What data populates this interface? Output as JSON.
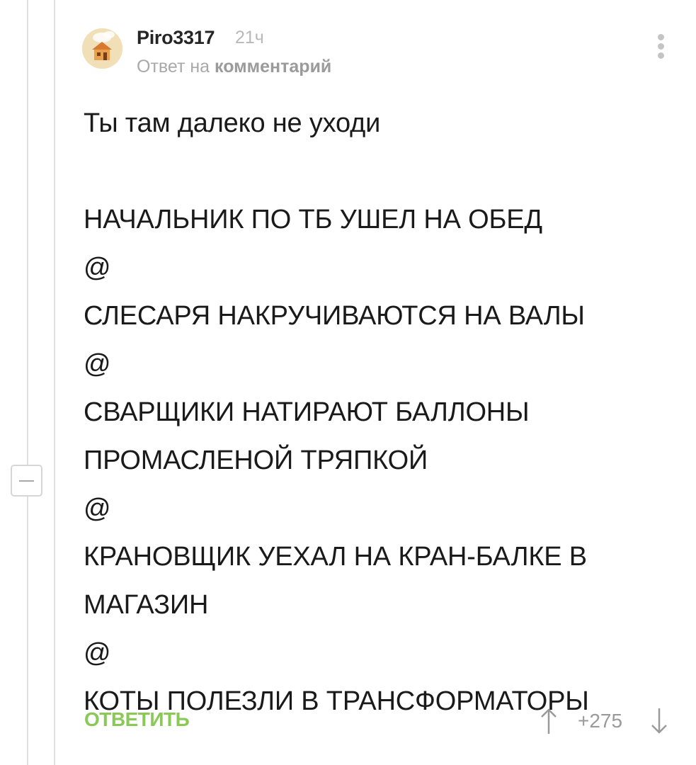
{
  "comment": {
    "author": "Piro3317",
    "time": "21ч",
    "reply_prefix": "Ответ на",
    "reply_link": "комментарий",
    "text_lines": [
      "Ты там далеко не уходи",
      "",
      "НАЧАЛЬНИК ПО ТБ УШЕЛ НА ОБЕД",
      "@",
      "СЛЕСАРЯ НАКРУЧИВАЮТСЯ НА ВАЛЫ",
      "@",
      "СВАРЩИКИ НАТИРАЮТ БАЛЛОНЫ",
      "ПРОМАСЛЕНОЙ ТРЯПКОЙ",
      "@",
      "КРАНОВЩИК УЕХАЛ НА КРАН-БАЛКЕ В",
      "МАГАЗИН",
      "@",
      "КОТЫ ПОЛЕЗЛИ В ТРАНСФОРМАТОРЫ"
    ],
    "actions": {
      "reply_label": "ОТВЕТИТЬ",
      "score": "+275"
    }
  },
  "icons": {
    "avatar": "avatar-house-image",
    "more": "vertical-dots-icon",
    "vote_up": "arrow-up-icon",
    "vote_down": "arrow-down-icon",
    "collapse": "collapse-minus-icon"
  },
  "colors": {
    "reply_button": "#8ac858",
    "thread_line": "#e1e1e1",
    "muted_text": "#a9a9a9"
  }
}
